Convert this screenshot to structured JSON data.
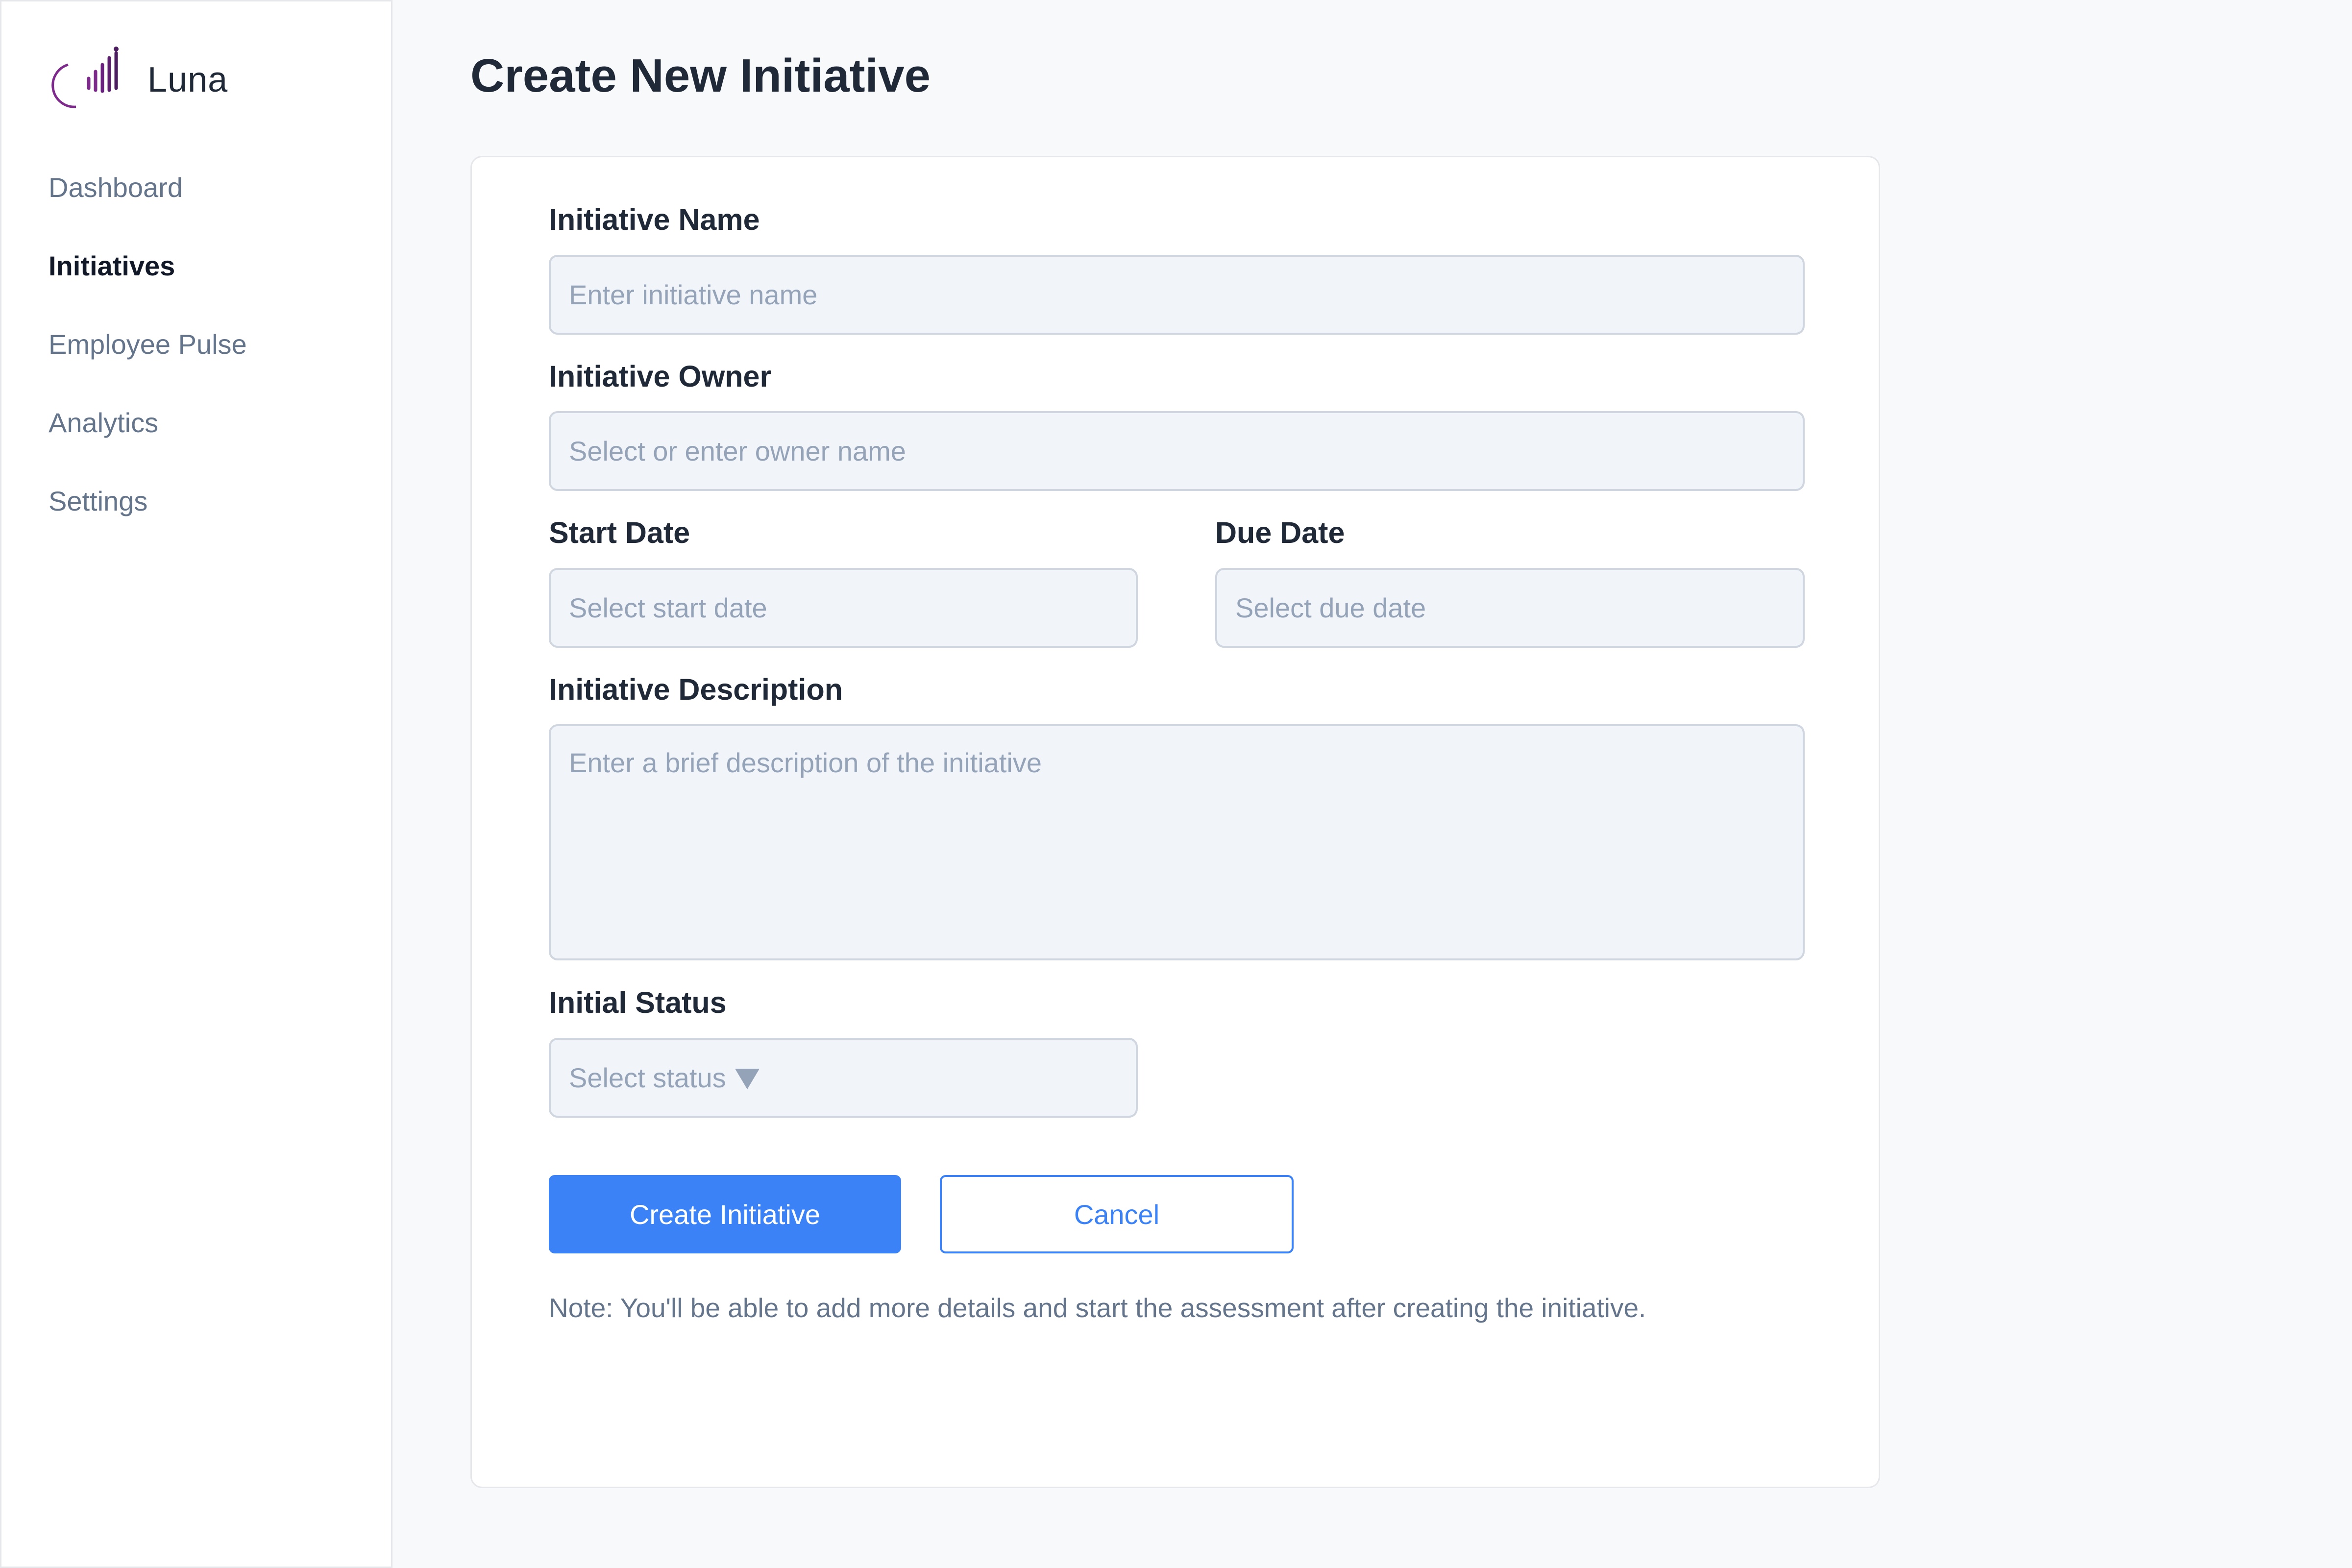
{
  "app": {
    "name": "Luna",
    "logo_icon": "luna-crescent-bars-logo",
    "logo_colors": [
      "#4c1d5e",
      "#7e2a8c"
    ]
  },
  "sidebar": {
    "items": [
      {
        "label": "Dashboard",
        "active": false
      },
      {
        "label": "Initiatives",
        "active": true
      },
      {
        "label": "Employee Pulse",
        "active": false
      },
      {
        "label": "Analytics",
        "active": false
      },
      {
        "label": "Settings",
        "active": false
      }
    ]
  },
  "page": {
    "title": "Create New Initiative"
  },
  "form": {
    "name": {
      "label": "Initiative Name",
      "placeholder": "Enter initiative name",
      "value": ""
    },
    "owner": {
      "label": "Initiative Owner",
      "placeholder": "Select or enter owner name",
      "value": ""
    },
    "start_date": {
      "label": "Start Date",
      "placeholder": "Select start date",
      "value": ""
    },
    "due_date": {
      "label": "Due Date",
      "placeholder": "Select due date",
      "value": ""
    },
    "description": {
      "label": "Initiative Description",
      "placeholder": "Enter a brief description of the initiative",
      "value": ""
    },
    "status": {
      "label": "Initial Status",
      "placeholder": "Select status",
      "icon": "caret-down-icon"
    },
    "create_label": "Create Initiative",
    "cancel_label": "Cancel",
    "note": "Note: You'll be able to add more details and start the assessment after creating the initiative."
  },
  "colors": {
    "accent": "#3b82f6",
    "sidebar_bg": "#ffffff",
    "page_bg": "#f8f9fb",
    "field_bg": "#f1f4f8",
    "heading": "#1f2937",
    "muted": "#64748b",
    "placeholder": "#94a3b8"
  }
}
